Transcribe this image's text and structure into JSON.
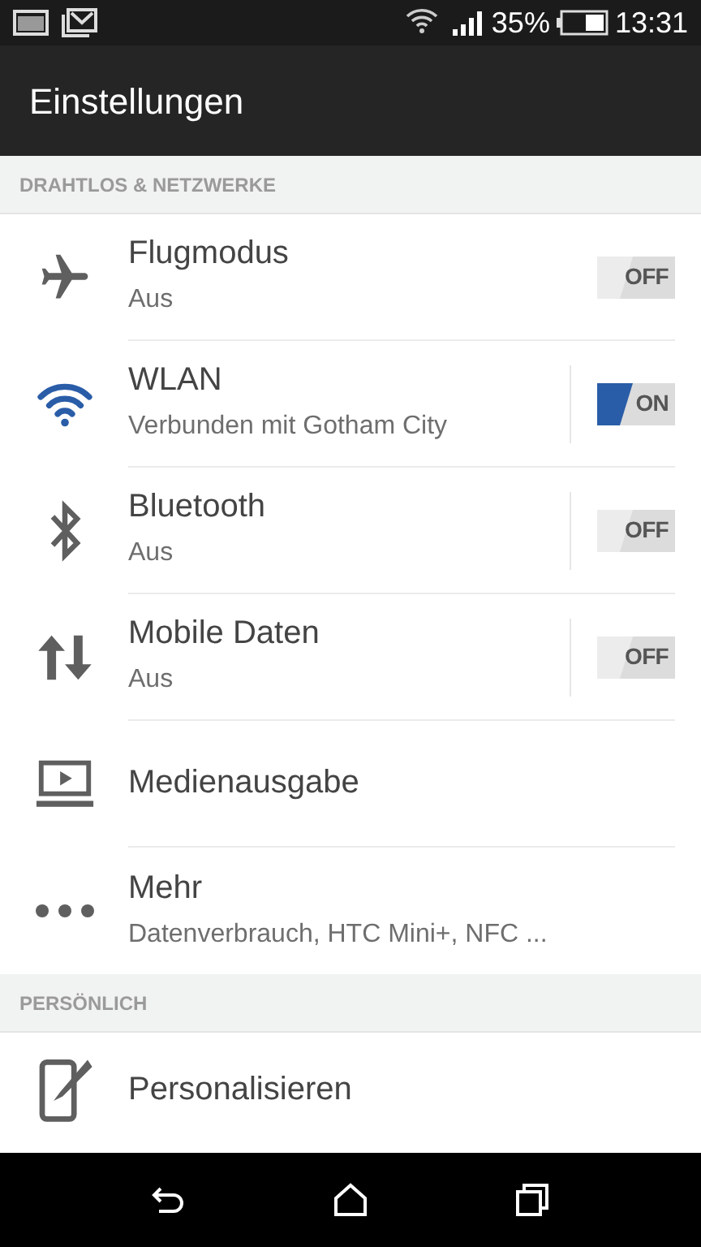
{
  "status_bar": {
    "battery_percent": "35%",
    "time": "13:31"
  },
  "app_bar": {
    "title": "Einstellungen"
  },
  "sections": [
    {
      "header": "DRAHTLOS & NETZWERKE",
      "items": [
        {
          "kind": "toggle",
          "title": "Flugmodus",
          "subtitle": "Aus",
          "on": false,
          "switch_label": "OFF",
          "split": false
        },
        {
          "kind": "toggle",
          "title": "WLAN",
          "subtitle": "Verbunden mit Gotham City",
          "on": true,
          "switch_label": "ON",
          "split": true
        },
        {
          "kind": "toggle",
          "title": "Bluetooth",
          "subtitle": "Aus",
          "on": false,
          "switch_label": "OFF",
          "split": true
        },
        {
          "kind": "toggle",
          "title": "Mobile Daten",
          "subtitle": "Aus",
          "on": false,
          "switch_label": "OFF",
          "split": true
        },
        {
          "kind": "plain",
          "title": "Medienausgabe"
        },
        {
          "kind": "plain",
          "title": "Mehr",
          "subtitle": "Datenverbrauch, HTC Mini+, NFC ..."
        }
      ]
    },
    {
      "header": "PERSÖNLICH",
      "items": [
        {
          "kind": "plain",
          "title": "Personalisieren"
        }
      ]
    }
  ]
}
